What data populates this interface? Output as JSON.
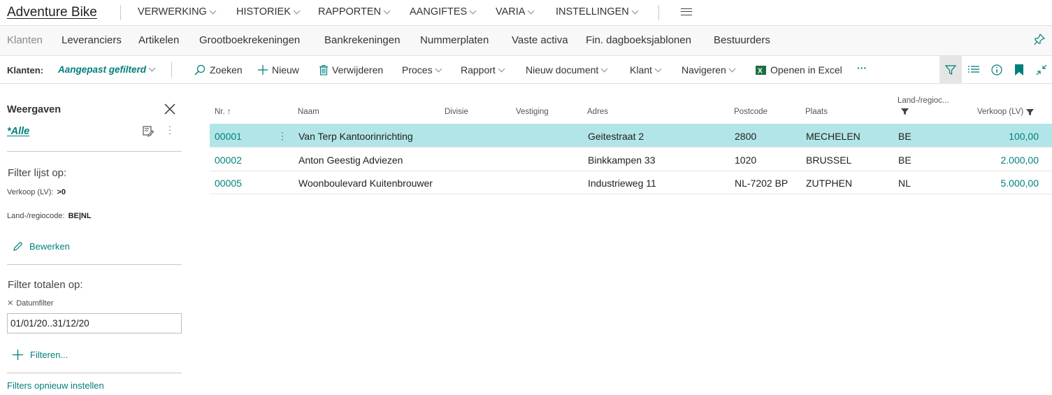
{
  "top": {
    "brand": "Adventure Bike",
    "menu": [
      "VERWERKING",
      "HISTORIEK",
      "RAPPORTEN",
      "AANGIFTES",
      "VARIA",
      "INSTELLINGEN"
    ]
  },
  "subnav": [
    "Klanten",
    "Leveranciers",
    "Artikelen",
    "Grootboekrekeningen",
    "Bankrekeningen",
    "Nummerplaten",
    "Vaste activa",
    "Fin. dagboeksjablonen",
    "Bestuurders"
  ],
  "actions": {
    "label": "Klanten:",
    "filter": "Aangepast gefilterd",
    "search": "Zoeken",
    "new": "Nieuw",
    "delete": "Verwijderen",
    "process": "Proces",
    "report": "Rapport",
    "new_document": "Nieuw document",
    "customer": "Klant",
    "navigate": "Navigeren",
    "excel": "Openen in Excel",
    "more": "···"
  },
  "panel": {
    "title": "Weergaven",
    "view": "*Alle",
    "filter_list_heading": "Filter lijst op:",
    "filter1_label": "Verkoop (LV):",
    "filter1_value": ">0",
    "filter2_label": "Land-/regiocode:",
    "filter2_value": "BE|NL",
    "edit": "Bewerken",
    "filter_totals_heading": "Filter totalen op:",
    "date_filter_label": "Datumfilter",
    "date_filter_value": "01/01/20..31/12/20",
    "add_filter": "Filteren...",
    "reset": "Filters opnieuw instellen"
  },
  "table": {
    "headers": {
      "no": "Nr. ↑",
      "name": "Naam",
      "division": "Divisie",
      "branch": "Vestiging",
      "address": "Adres",
      "postcode": "Postcode",
      "city": "Plaats",
      "country": "Land-/regioc...",
      "sales": "Verkoop (LV)"
    },
    "rows": [
      {
        "no": "00001",
        "name": "Van Terp Kantoorinrichting",
        "division": "",
        "branch": "",
        "address": "Geitestraat 2",
        "postcode": "2800",
        "city": "MECHELEN",
        "country": "BE",
        "sales": "100,00"
      },
      {
        "no": "00002",
        "name": "Anton Geestig Adviezen",
        "division": "",
        "branch": "",
        "address": "Binkkampen 33",
        "postcode": "1020",
        "city": "BRUSSEL",
        "country": "BE",
        "sales": "2.000,00"
      },
      {
        "no": "00005",
        "name": "Woonboulevard Kuitenbrouwer",
        "division": "",
        "branch": "",
        "address": "Industrieweg 11",
        "postcode": "NL-7202 BP",
        "city": "ZUTPHEN",
        "country": "NL",
        "sales": "5.000,00"
      }
    ]
  },
  "colors": {
    "accent": "#00807c",
    "selected_row": "#b2e5e7"
  }
}
